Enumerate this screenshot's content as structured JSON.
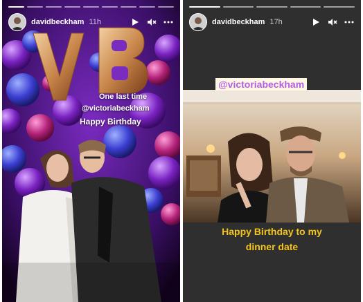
{
  "left_story": {
    "username": "davidbeckham",
    "time": "11h",
    "balloon_letters": "VB",
    "overlay": {
      "line1": "One last time",
      "line2": "@victoriabeckham",
      "line3": "Happy Birthday"
    },
    "progress": {
      "segments": 9,
      "current": 1
    }
  },
  "right_story": {
    "username": "davidbeckham",
    "time": "17h",
    "mention": "@victoriabeckham",
    "caption_line1": "Happy Birthday to my",
    "caption_line2": "dinner date",
    "progress": {
      "segments": 5,
      "current": 1
    }
  },
  "icons": [
    "avatar",
    "play-icon",
    "mute-icon",
    "more-icon"
  ],
  "colors": {
    "mention_text": "#b35ee8",
    "caption_text": "#f5c51b",
    "balloon_gold": "#c9874b",
    "balloon_purple": "#6c1fa6"
  }
}
